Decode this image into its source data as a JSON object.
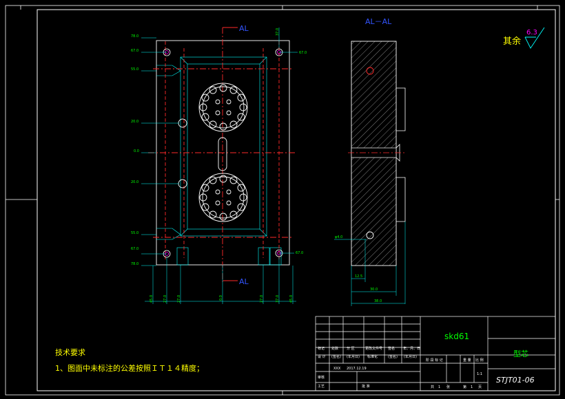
{
  "section_labels": {
    "top": "AL",
    "bottom": "AL",
    "side_title": "AL－AL"
  },
  "roughness": {
    "prefix": "其余",
    "value": "6.3"
  },
  "front_dims": {
    "left": [
      "78.0",
      "67.0",
      "55.0",
      "20.0",
      "0.0",
      "20.0",
      "55.0",
      "67.0",
      "78.0"
    ],
    "right": [
      "67.0",
      "67.0"
    ],
    "top": "37.0",
    "bottom": [
      "45.0",
      "27.0",
      "27.0",
      "0.0",
      "27.0",
      "37.0",
      "45.0"
    ]
  },
  "side_dims": {
    "hole": "φ4.0",
    "d1": "12.5",
    "d2": "30.0",
    "d3": "38.0"
  },
  "tech": {
    "title": "技术要求",
    "item1": "1、图面中未标注的公差按照ＩＴ１４精度；"
  },
  "title_block": {
    "material": "skd61",
    "part_name": "型芯",
    "drawing_no": "STJT01-06",
    "scale": "1:1",
    "row_headers": [
      "标记",
      "处数",
      "分 区",
      "更改文件号",
      "签名",
      "年、月、日"
    ],
    "design_row": [
      "设 计",
      "(签名)",
      "(年月日)",
      "标准化",
      "(签名)",
      "(年月日)"
    ],
    "designer": "XXX",
    "date": "2017.12.19",
    "review": "审核",
    "process": "工艺",
    "approve": "批 准",
    "stage_headers": [
      "阶 段 标 记",
      "重 量",
      "比 例"
    ],
    "sheets": [
      "共",
      "1",
      "张",
      "第",
      "1",
      "页"
    ]
  }
}
